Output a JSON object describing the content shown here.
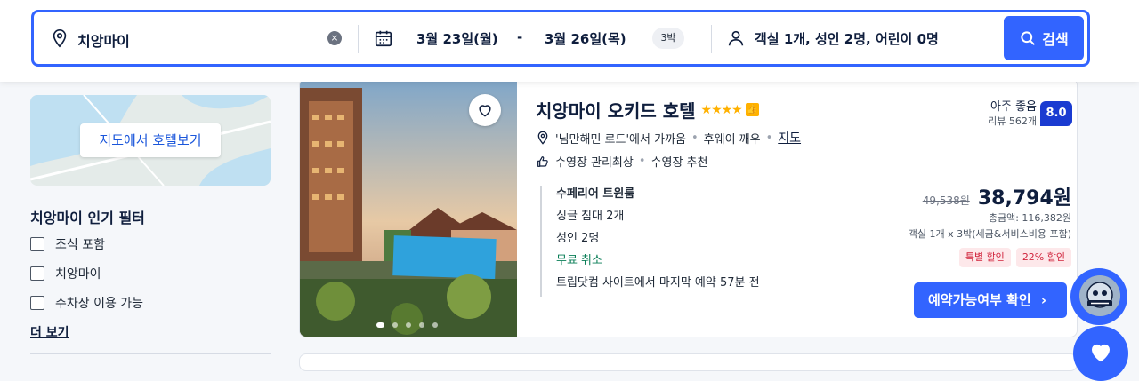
{
  "search": {
    "location": "치앙마이",
    "checkin": "3월 23일(월)",
    "dash": "-",
    "checkout": "3월 26일(목)",
    "nights": "3박",
    "guests": "객실 1개, 성인 2명, 어린이 0명",
    "button_label": "검색"
  },
  "sidebar": {
    "map_button": "지도에서 호텔보기",
    "filter_title": "치앙마이 인기 필터",
    "filters": [
      {
        "label": "조식 포함"
      },
      {
        "label": "치앙마이"
      },
      {
        "label": "주차장 이용 가능"
      }
    ],
    "more_label": "더 보기"
  },
  "hotel": {
    "name": "치앙마이 오키드 호텔",
    "stars": "★★★★",
    "star_count": 4,
    "location_text": "'님만해민 로드'에서 가까움",
    "tag_takeout": "후웨이 깨우",
    "map_link": "지도",
    "amenity_1": "수영장 관리최상",
    "amenity_2": "수영장 추천",
    "rating_label": "아주 좋음",
    "review_count": "리뷰 562개",
    "score": "8.0",
    "room": {
      "name": "수페리어 트윈룸",
      "bed": "싱글 침대 2개",
      "occupancy": "성인 2명",
      "cancellation": "무료 취소",
      "last_booked": "트립닷컴 사이트에서 마지막 예약 57분 전"
    },
    "old_price": "49,538원",
    "price": "38,794원",
    "total": "총금액: 116,382원",
    "room_nights": "객실 1개 x 3박(세금&서비스비용 포함)",
    "badge_special": "특별 할인",
    "badge_discount": "22% 할인",
    "book_button": "예약가능여부 확인"
  },
  "colors": {
    "accent": "#3264ff",
    "score_bg": "#1a3bd1",
    "discount_red": "#d0213a",
    "cancel_green": "#0a7e57"
  }
}
